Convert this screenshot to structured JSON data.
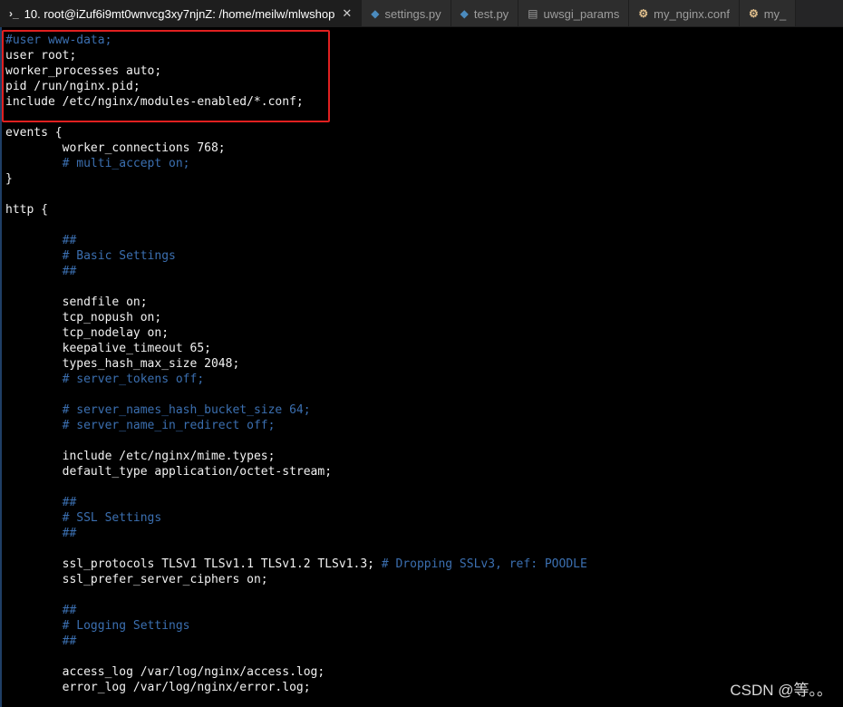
{
  "tabs": [
    {
      "icon": "terminal-icon",
      "label": "10. root@iZuf6i9mt0wnvcg3xy7njnZ: /home/meilw/mlwshop",
      "active": true,
      "close": "✕"
    },
    {
      "icon": "python-file-icon",
      "label": "settings.py"
    },
    {
      "icon": "python-file-icon",
      "label": "test.py"
    },
    {
      "icon": "file-icon",
      "label": "uwsgi_params"
    },
    {
      "icon": "config-file-icon",
      "label": "my_nginx.conf"
    },
    {
      "icon": "config-file-icon",
      "label": "my_"
    }
  ],
  "code_lines": [
    {
      "indent": "",
      "text": "",
      "comment": "#user www-data;"
    },
    {
      "indent": "",
      "text": "user root;",
      "comment": ""
    },
    {
      "indent": "",
      "text": "worker_processes auto;",
      "comment": ""
    },
    {
      "indent": "",
      "text": "pid /run/nginx.pid;",
      "comment": ""
    },
    {
      "indent": "",
      "text": "include /etc/nginx/modules-enabled/*.conf;",
      "comment": ""
    },
    {
      "indent": "",
      "text": "",
      "comment": ""
    },
    {
      "indent": "",
      "text": "events {",
      "comment": ""
    },
    {
      "indent": "        ",
      "text": "worker_connections 768;",
      "comment": ""
    },
    {
      "indent": "        ",
      "text": "",
      "comment": "# multi_accept on;"
    },
    {
      "indent": "",
      "text": "}",
      "comment": ""
    },
    {
      "indent": "",
      "text": "",
      "comment": ""
    },
    {
      "indent": "",
      "text": "http {",
      "comment": ""
    },
    {
      "indent": "",
      "text": "",
      "comment": ""
    },
    {
      "indent": "        ",
      "text": "",
      "comment": "##"
    },
    {
      "indent": "        ",
      "text": "",
      "comment": "# Basic Settings"
    },
    {
      "indent": "        ",
      "text": "",
      "comment": "##"
    },
    {
      "indent": "",
      "text": "",
      "comment": ""
    },
    {
      "indent": "        ",
      "text": "sendfile on;",
      "comment": ""
    },
    {
      "indent": "        ",
      "text": "tcp_nopush on;",
      "comment": ""
    },
    {
      "indent": "        ",
      "text": "tcp_nodelay on;",
      "comment": ""
    },
    {
      "indent": "        ",
      "text": "keepalive_timeout 65;",
      "comment": ""
    },
    {
      "indent": "        ",
      "text": "types_hash_max_size 2048;",
      "comment": ""
    },
    {
      "indent": "        ",
      "text": "",
      "comment": "# server_tokens off;"
    },
    {
      "indent": "",
      "text": "",
      "comment": ""
    },
    {
      "indent": "        ",
      "text": "",
      "comment": "# server_names_hash_bucket_size 64;"
    },
    {
      "indent": "        ",
      "text": "",
      "comment": "# server_name_in_redirect off;"
    },
    {
      "indent": "",
      "text": "",
      "comment": ""
    },
    {
      "indent": "        ",
      "text": "include /etc/nginx/mime.types;",
      "comment": ""
    },
    {
      "indent": "        ",
      "text": "default_type application/octet-stream;",
      "comment": ""
    },
    {
      "indent": "",
      "text": "",
      "comment": ""
    },
    {
      "indent": "        ",
      "text": "",
      "comment": "##"
    },
    {
      "indent": "        ",
      "text": "",
      "comment": "# SSL Settings"
    },
    {
      "indent": "        ",
      "text": "",
      "comment": "##"
    },
    {
      "indent": "",
      "text": "",
      "comment": ""
    },
    {
      "indent": "        ",
      "text": "ssl_protocols TLSv1 TLSv1.1 TLSv1.2 TLSv1.3; ",
      "comment": "# Dropping SSLv3, ref: POODLE"
    },
    {
      "indent": "        ",
      "text": "ssl_prefer_server_ciphers on;",
      "comment": ""
    },
    {
      "indent": "",
      "text": "",
      "comment": ""
    },
    {
      "indent": "        ",
      "text": "",
      "comment": "##"
    },
    {
      "indent": "        ",
      "text": "",
      "comment": "# Logging Settings"
    },
    {
      "indent": "        ",
      "text": "",
      "comment": "##"
    },
    {
      "indent": "",
      "text": "",
      "comment": ""
    },
    {
      "indent": "        ",
      "text": "access_log /var/log/nginx/access.log;",
      "comment": ""
    },
    {
      "indent": "        ",
      "text": "error_log /var/log/nginx/error.log;",
      "comment": ""
    }
  ],
  "watermark": "CSDN @等。。",
  "colors": {
    "background": "#000000",
    "text": "#f2f2f2",
    "comment": "#3b6fb0",
    "highlight_box": "#e02020"
  }
}
